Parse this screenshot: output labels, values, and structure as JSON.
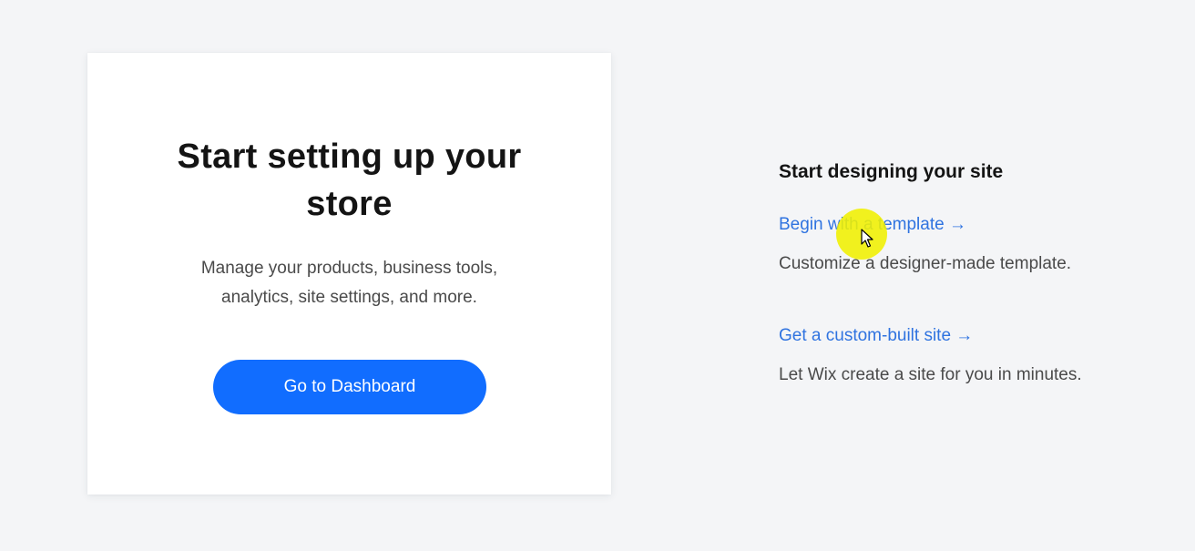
{
  "store_card": {
    "title": "Start setting up your store",
    "description": "Manage your products, business tools, analytics, site settings, and more.",
    "button_label": "Go to Dashboard"
  },
  "design_section": {
    "title": "Start designing your site",
    "options": [
      {
        "link_label": "Begin with a template →",
        "description": "Customize a designer-made template."
      },
      {
        "link_label": "Get a custom-built site →",
        "description": "Let Wix create a site for you in minutes."
      }
    ]
  },
  "colors": {
    "background": "#f4f5f7",
    "primary_button": "#116dff",
    "link": "#2f73e0",
    "heading": "#141414",
    "body_text": "#4a4a4a"
  }
}
